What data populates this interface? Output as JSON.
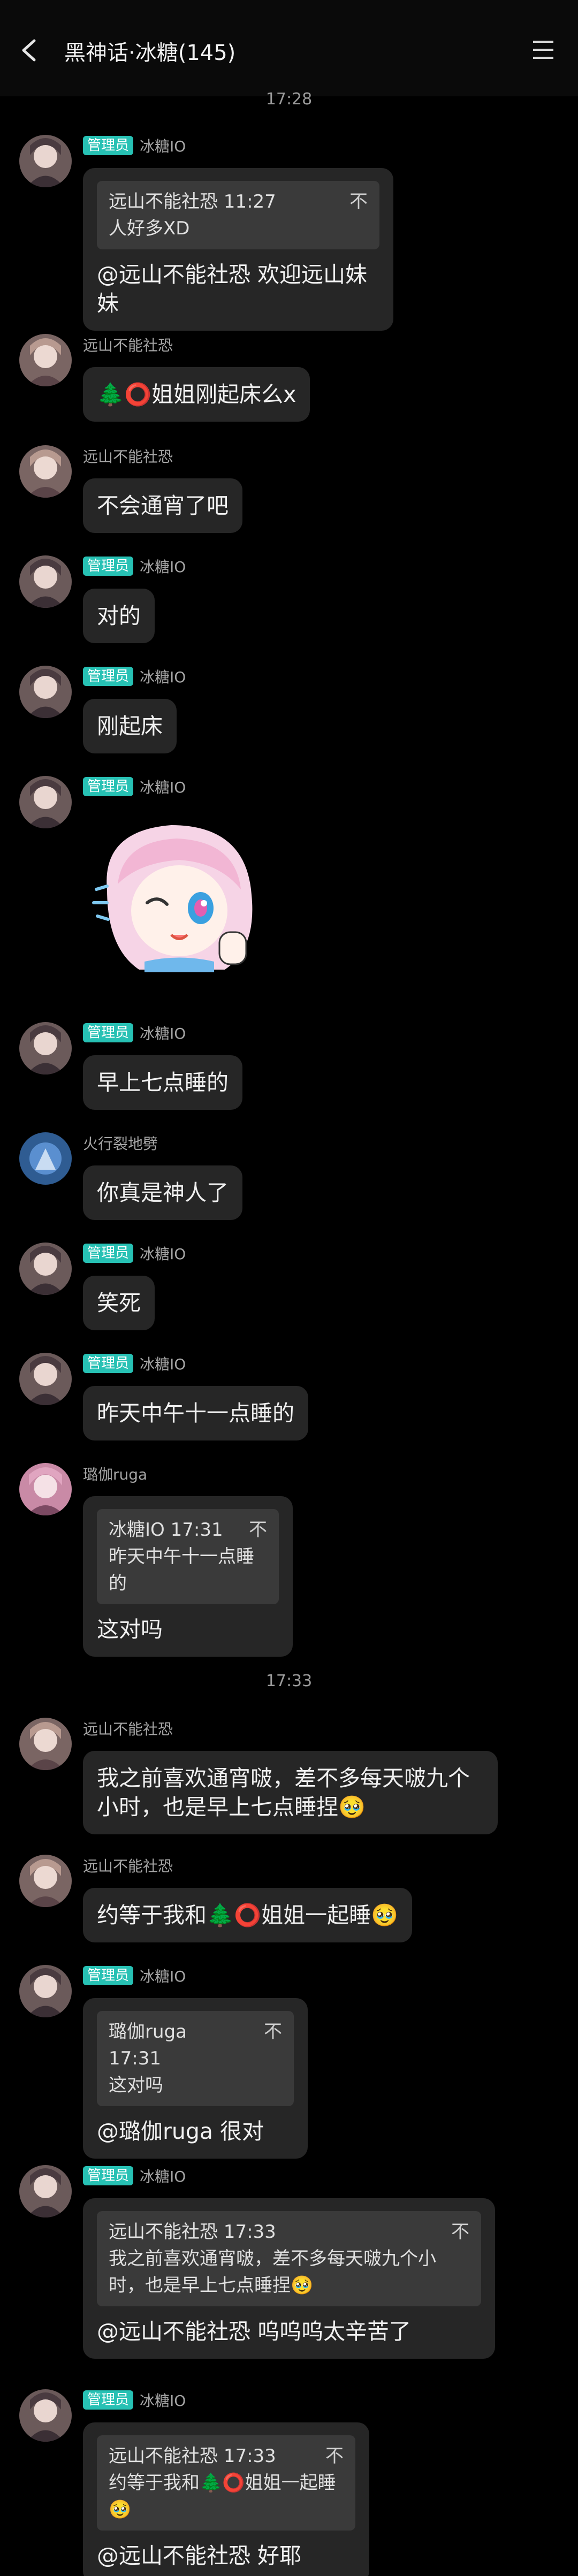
{
  "header": {
    "title": "黑神话·冰糖(145)"
  },
  "times": [
    "17:28",
    "17:33"
  ],
  "badge_label": "管理员",
  "messages": [
    {
      "sender": "冰糖IO",
      "admin": true,
      "quote": {
        "head": "远山不能社恐 11:27",
        "x": "不",
        "body": "人好多XD"
      },
      "text": "@远山不能社恐 欢迎远山妹妹"
    },
    {
      "sender": "远山不能社恐",
      "admin": false,
      "text": "🌲⭕姐姐刚起床么x"
    },
    {
      "sender": "远山不能社恐",
      "admin": false,
      "text": "不会通宵了吧"
    },
    {
      "sender": "冰糖IO",
      "admin": true,
      "text": "对的"
    },
    {
      "sender": "冰糖IO",
      "admin": true,
      "text": "刚起床"
    },
    {
      "sender": "冰糖IO",
      "admin": true,
      "sticker": true
    },
    {
      "sender": "冰糖IO",
      "admin": true,
      "text": "早上七点睡的"
    },
    {
      "sender": "火行裂地劈",
      "admin": false,
      "text": "你真是神人了"
    },
    {
      "sender": "冰糖IO",
      "admin": true,
      "text": "笑死"
    },
    {
      "sender": "冰糖IO",
      "admin": true,
      "text": "昨天中午十一点睡的"
    },
    {
      "sender": "璐伽ruga",
      "admin": false,
      "quote": {
        "head": "冰糖IO 17:31",
        "x": "不",
        "body": "昨天中午十一点睡的"
      },
      "text": "这对吗"
    },
    {
      "sender": "远山不能社恐",
      "admin": false,
      "text": "我之前喜欢通宵啵，差不多每天啵九个小时，也是早上七点睡捏🥹"
    },
    {
      "sender": "远山不能社恐",
      "admin": false,
      "text": "约等于我和🌲⭕姐姐一起睡🥹"
    },
    {
      "sender": "冰糖IO",
      "admin": true,
      "quote": {
        "head": "璐伽ruga 17:31",
        "x": "不",
        "body": "这对吗"
      },
      "text": "@璐伽ruga 很对"
    },
    {
      "sender": "冰糖IO",
      "admin": true,
      "quote": {
        "head": "远山不能社恐 17:33",
        "x": "不",
        "body": "我之前喜欢通宵啵，差不多每天啵九个小时，也是早上七点睡捏🥹"
      },
      "text": "@远山不能社恐 呜呜呜太辛苦了"
    },
    {
      "sender": "冰糖IO",
      "admin": true,
      "quote": {
        "head": "远山不能社恐 17:33",
        "x": "不",
        "body": "约等于我和🌲⭕姐姐一起睡🥹"
      },
      "text": "@远山不能社恐 好耶"
    }
  ]
}
